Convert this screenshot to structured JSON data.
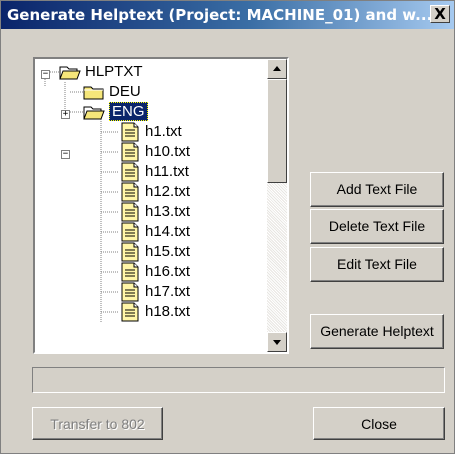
{
  "window": {
    "title": "Generate Helptext (Project: MACHINE_01) and w...",
    "close_label": "X"
  },
  "tree": {
    "nodes": [
      {
        "label": "HLPTXT",
        "level": 0,
        "type": "folder-open",
        "expander": "minus"
      },
      {
        "label": "DEU",
        "level": 1,
        "type": "folder",
        "expander": "plus"
      },
      {
        "label": "ENG",
        "level": 1,
        "type": "folder-open",
        "expander": "minus",
        "selected": true
      },
      {
        "label": "h1.txt",
        "level": 2,
        "type": "file"
      },
      {
        "label": "h10.txt",
        "level": 2,
        "type": "file"
      },
      {
        "label": "h11.txt",
        "level": 2,
        "type": "file"
      },
      {
        "label": "h12.txt",
        "level": 2,
        "type": "file"
      },
      {
        "label": "h13.txt",
        "level": 2,
        "type": "file"
      },
      {
        "label": "h14.txt",
        "level": 2,
        "type": "file"
      },
      {
        "label": "h15.txt",
        "level": 2,
        "type": "file"
      },
      {
        "label": "h16.txt",
        "level": 2,
        "type": "file"
      },
      {
        "label": "h17.txt",
        "level": 2,
        "type": "file"
      },
      {
        "label": "h18.txt",
        "level": 2,
        "type": "file"
      }
    ]
  },
  "buttons": {
    "add_text_file": "Add Text File",
    "delete_text_file": "Delete Text File",
    "edit_text_file": "Edit Text File",
    "generate_helptext": "Generate Helptext",
    "transfer": "Transfer to 802",
    "close": "Close"
  },
  "progress": {
    "value": 0
  },
  "colors": {
    "title_start": "#0a246a",
    "title_end": "#a6caf0",
    "face": "#d4d0c8",
    "folder": "#f5e67a",
    "file": "#fff6a8"
  }
}
